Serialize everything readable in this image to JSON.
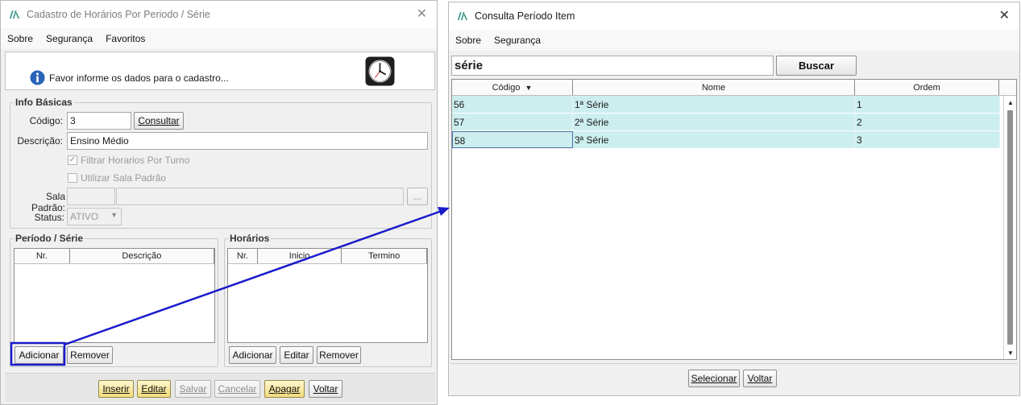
{
  "window1": {
    "title": "Cadastro de Horários Por Periodo / Série",
    "menu": [
      "Sobre",
      "Segurança",
      "Favoritos"
    ],
    "info_message": "Favor informe os dados para o cadastro...",
    "info_basicas": {
      "legend": "Info Básicas",
      "codigo_label": "Código:",
      "codigo_value": "3",
      "consultar_button": "Consultar",
      "descricao_label": "Descrição:",
      "descricao_value": "Ensino Médio",
      "filtrar_label": "Filtrar Horarios Por Turno",
      "utilizar_label": "Utilizar Sala Padrão",
      "sala_label": "Sala Padrão:",
      "sala_button": "...",
      "status_label": "Status:",
      "status_value": "ATIVO"
    },
    "periodo": {
      "legend": "Período / Série",
      "columns": [
        "Nr.",
        "Descrição"
      ],
      "buttons": [
        "Adicionar",
        "Remover"
      ]
    },
    "horarios": {
      "legend": "Horários",
      "columns": [
        "Nr.",
        "Inicio",
        "Termino"
      ],
      "buttons": [
        "Adicionar",
        "Editar",
        "Remover"
      ]
    },
    "footer_buttons": [
      "Inserir",
      "Editar",
      "Salvar",
      "Cancelar",
      "Apagar",
      "Voltar"
    ]
  },
  "window2": {
    "title": "Consulta Período Item",
    "menu": [
      "Sobre",
      "Segurança"
    ],
    "search_value": "série",
    "search_button": "Buscar",
    "columns": [
      "Código",
      "Nome",
      "Ordem"
    ],
    "rows": [
      {
        "codigo": "56",
        "nome": "1ª Série",
        "ordem": "1"
      },
      {
        "codigo": "57",
        "nome": "2ª Série",
        "ordem": "2"
      },
      {
        "codigo": "58",
        "nome": "3ª Série",
        "ordem": "3"
      }
    ],
    "footer_buttons": [
      "Selecionar",
      "Voltar"
    ]
  },
  "colors": {
    "highlight": "#1a1acc",
    "row_bg": "#cdeeee",
    "yellow_button": "#f2dc7e"
  }
}
